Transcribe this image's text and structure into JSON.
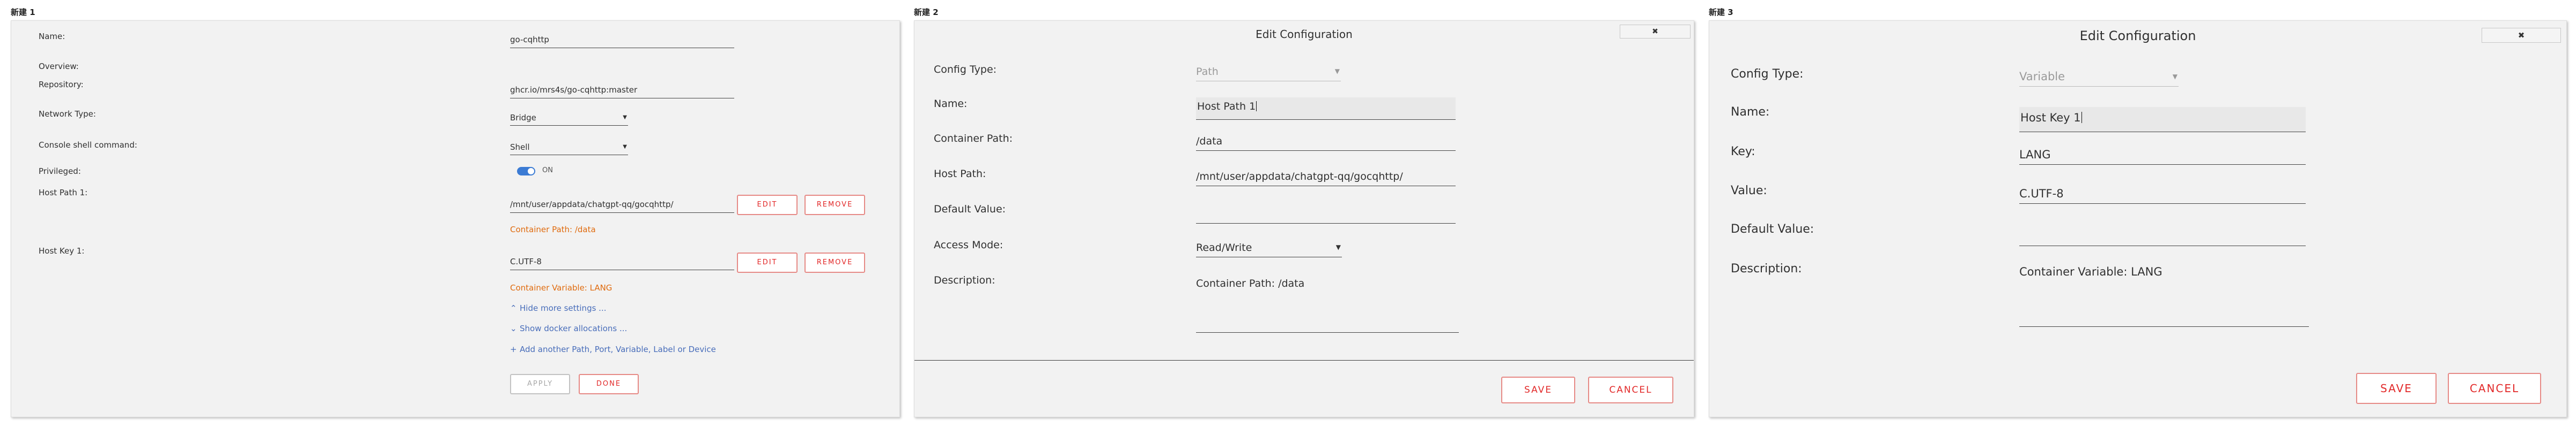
{
  "captions": [
    "新建 1",
    "新建 2",
    "新建 3"
  ],
  "colors": {
    "accent": "#e22828",
    "hint": "#e06b0e",
    "link": "#486dba",
    "toggle": "#3b7bd4"
  },
  "panel1": {
    "labels": {
      "name": "Name:",
      "overview": "Overview:",
      "repository": "Repository:",
      "network_type": "Network Type:",
      "console_shell": "Console shell command:",
      "privileged": "Privileged:",
      "host_path": "Host Path 1:",
      "host_key": "Host Key 1:"
    },
    "values": {
      "name": "go-cqhttp",
      "repository": "ghcr.io/mrs4s/go-cqhttp:master",
      "network_type": "Bridge",
      "console_shell": "Shell",
      "privileged_state": "ON",
      "host_path": "/mnt/user/appdata/chatgpt-qq/gocqhttp/",
      "host_key": "C.UTF-8"
    },
    "hints": {
      "container_path": "Container Path: /data",
      "container_variable": "Container Variable: LANG"
    },
    "links": {
      "hide_more": "Hide more settings ...",
      "show_docker": "Show docker allocations ...",
      "add_another": "Add another Path, Port, Variable, Label or Device"
    },
    "buttons": {
      "edit": "EDIT",
      "remove": "REMOVE",
      "apply": "APPLY",
      "done": "DONE"
    },
    "icons": {
      "hide": "chevron-up-icon",
      "show": "chevron-down-icon",
      "add": "plus-icon"
    }
  },
  "panel2": {
    "title": "Edit Configuration",
    "close": "✖",
    "labels": {
      "config_type": "Config Type:",
      "name": "Name:",
      "container_path": "Container Path:",
      "host_path": "Host Path:",
      "default_value": "Default Value:",
      "access_mode": "Access Mode:",
      "description": "Description:"
    },
    "values": {
      "config_type": "Path",
      "name": "Host Path 1",
      "container_path": "/data",
      "host_path": "/mnt/user/appdata/chatgpt-qq/gocqhttp/",
      "default_value": "",
      "access_mode": "Read/Write",
      "description": "Container Path: /data"
    },
    "buttons": {
      "save": "SAVE",
      "cancel": "CANCEL"
    }
  },
  "panel3": {
    "title": "Edit Configuration",
    "close": "✖",
    "labels": {
      "config_type": "Config Type:",
      "name": "Name:",
      "key": "Key:",
      "value": "Value:",
      "default_value": "Default Value:",
      "description": "Description:"
    },
    "values": {
      "config_type": "Variable",
      "name": "Host Key 1",
      "key": "LANG",
      "value": "C.UTF-8",
      "default_value": "",
      "description": "Container Variable: LANG"
    },
    "buttons": {
      "save": "SAVE",
      "cancel": "CANCEL"
    }
  }
}
